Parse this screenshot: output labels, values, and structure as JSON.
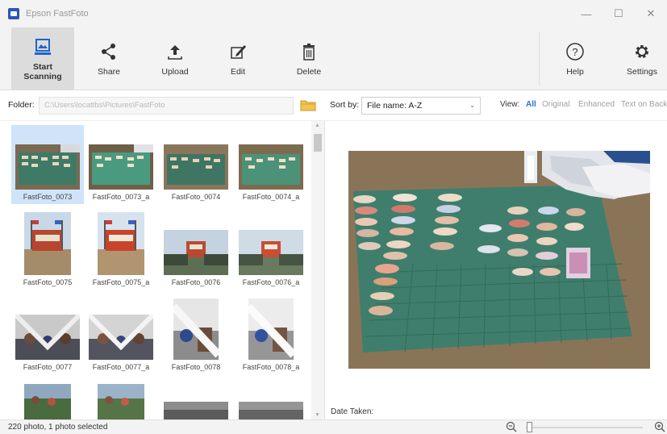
{
  "window": {
    "title": "Epson FastFoto"
  },
  "toolbar": {
    "start_scanning": "Start\nScanning",
    "share": "Share",
    "upload": "Upload",
    "edit": "Edit",
    "delete": "Delete",
    "help": "Help",
    "settings": "Settings"
  },
  "folder": {
    "label": "Folder:",
    "path": "C:\\Users\\locattbs\\Pictures\\FastFoto"
  },
  "sort": {
    "label": "Sort by:",
    "value": "File name: A-Z"
  },
  "view": {
    "label": "View:",
    "options": [
      "All",
      "Original",
      "Enhanced",
      "Text on Back"
    ],
    "selected": "All"
  },
  "thumbnails": [
    "FastFoto_0073",
    "FastFoto_0073_a",
    "FastFoto_0074",
    "FastFoto_0074_a",
    "FastFoto_0075",
    "FastFoto_0075_a",
    "FastFoto_0076",
    "FastFoto_0076_a",
    "FastFoto_0077",
    "FastFoto_0077_a",
    "FastFoto_0078",
    "FastFoto_0078_a"
  ],
  "preview": {
    "date_label": "Date Taken:"
  },
  "status": {
    "text": "220 photo, 1 photo selected"
  },
  "colors": {
    "accent": "#2b6fd6",
    "selection": "#cfe4f8",
    "chrome": "#f3f3f3"
  },
  "icons": {
    "app": "fastfoto-app-icon",
    "start": "scanner-icon",
    "share": "share-icon",
    "upload": "upload-icon",
    "edit": "edit-icon",
    "delete": "trash-icon",
    "help": "help-icon",
    "settings": "gear-icon",
    "folder": "folder-icon",
    "zoom_out": "zoom-out-icon",
    "zoom_in": "zoom-in-icon"
  }
}
